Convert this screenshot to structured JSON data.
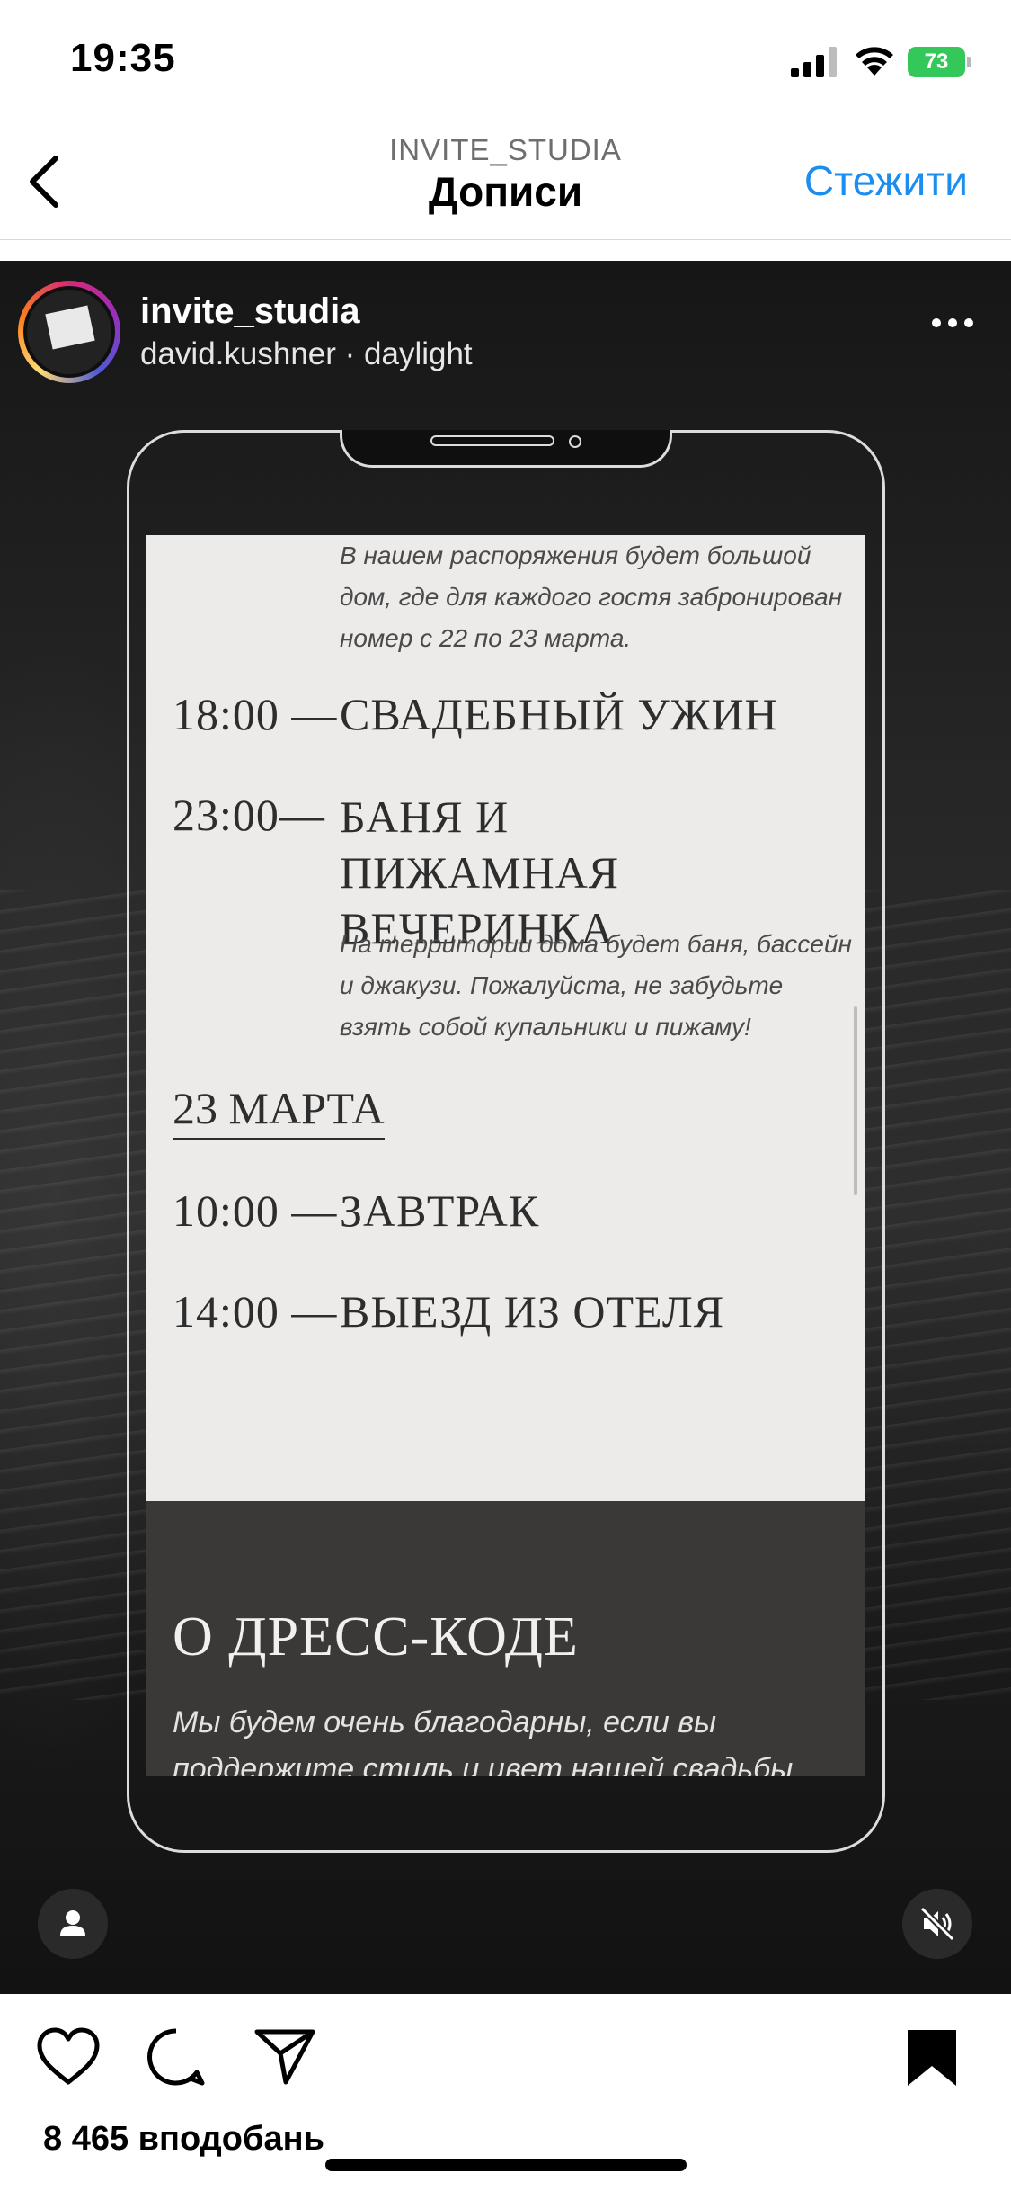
{
  "status_bar": {
    "time": "19:35",
    "battery": "73"
  },
  "nav": {
    "subtitle": "INVITE_STUDIA",
    "title": "Дописи",
    "follow_label": "Стежити"
  },
  "post": {
    "username": "invite_studia",
    "subline": "david.kushner · daylight",
    "invite": {
      "intro": "В нашем распоряжения будет большой дом, где для каждого гостя забронирован номер с 22 по 23 марта.",
      "events_day1": [
        {
          "time": "18:00 —",
          "name": "СВАДЕБНЫЙ УЖИН"
        },
        {
          "time": "23:00—",
          "name": "БАНЯ И ПИЖАМНАЯ ВЕЧЕРИНКА"
        }
      ],
      "event2_desc": "На территории дома будет баня, бассейн и джакузи. Пожалуйста, не забудьте взять собой купальники и пижаму!",
      "date_heading": "23 МАРТА",
      "events_day2": [
        {
          "time": "10:00 —",
          "name": "ЗАВТРАК"
        },
        {
          "time": "14:00 —",
          "name": "ВЫЕЗД ИЗ ОТЕЛЯ"
        }
      ],
      "dress_title": "О ДРЕСС-КОДЕ",
      "dress_text": "Мы будем очень благодарны, если вы поддержите стиль и цвет нашей свадьбы"
    }
  },
  "actions": {
    "likes": "8 465 вподобань"
  },
  "colors": {
    "accent": "#1c8ef0",
    "paper": "#ecebea",
    "dark_card": "#3a3937",
    "battery": "#34c759"
  },
  "icons": [
    "back-chevron-icon",
    "more-dots-icon",
    "user-icon",
    "mute-icon",
    "heart-icon",
    "comment-icon",
    "share-icon",
    "bookmark-icon",
    "signal-icon",
    "wifi-icon",
    "battery-icon"
  ]
}
